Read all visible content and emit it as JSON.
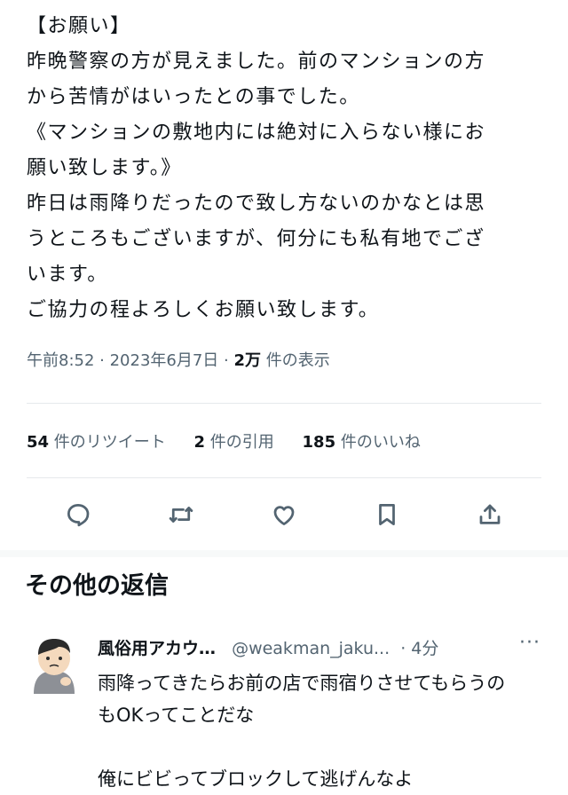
{
  "tweet": {
    "lines": [
      "【お願い】",
      "昨晩警察の方が見えました。前のマンションの方",
      "から苦情がはいったとの事でした。",
      "《マンションの敷地内には絶対に入らない様にお",
      "願い致します。》",
      "昨日は雨降りだったので致し方ないのかなとは思",
      "うところもございますが、何分にも私有地でござ",
      "います。",
      "ご協力の程よろしくお願い致します。"
    ],
    "time": "午前8:52 · 2023年6月7日 ·",
    "views_count": "2万",
    "views_label": "件の表示"
  },
  "stats": {
    "retweets_count": "54",
    "retweets_label": "件のリツイート",
    "quotes_count": "2",
    "quotes_label": "件の引用",
    "likes_count": "185",
    "likes_label": "件のいいね"
  },
  "actions": {
    "icons": [
      "reply-icon",
      "retweet-icon",
      "like-icon",
      "bookmark-icon",
      "share-icon"
    ]
  },
  "replies_section": {
    "title": "その他の返信"
  },
  "reply": {
    "name": "風俗用アカウ…",
    "handle": "@weakman_jaku...",
    "time": "· 4分",
    "more": "···",
    "lines": [
      "雨降ってきたらお前の店で雨宿りさせてもらうの",
      "もOKってことだな",
      "",
      "俺にビビってブロックして逃げんなよ"
    ]
  }
}
